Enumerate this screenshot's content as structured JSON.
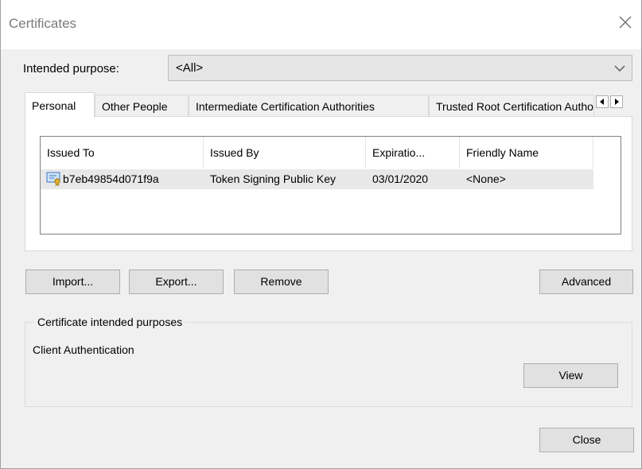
{
  "window": {
    "title": "Certificates"
  },
  "purpose": {
    "label": "Intended purpose:",
    "value": "<All>"
  },
  "tabs": [
    {
      "label": "Personal",
      "active": true
    },
    {
      "label": "Other People",
      "active": false
    },
    {
      "label": "Intermediate Certification Authorities",
      "active": false
    },
    {
      "label": "Trusted Root Certification Authorities",
      "active": false
    }
  ],
  "table": {
    "columns": [
      "Issued To",
      "Issued By",
      "Expiratio...",
      "Friendly Name"
    ],
    "rows": [
      {
        "issued_to": "b7eb49854d071f9a",
        "issued_by": "Token Signing Public Key",
        "expiration": "03/01/2020",
        "friendly_name": "<None>",
        "icon": "certificate-icon",
        "selected": true
      }
    ]
  },
  "buttons": {
    "import": "Import...",
    "export": "Export...",
    "remove": "Remove",
    "advanced": "Advanced",
    "view": "View",
    "close": "Close"
  },
  "purposes_group": {
    "legend": "Certificate intended purposes",
    "text": "Client Authentication"
  },
  "icons": {
    "close": "close-icon",
    "dropdown": "chevron-down-icon",
    "scroll_left": "scroll-left-icon",
    "scroll_right": "scroll-right-icon"
  }
}
